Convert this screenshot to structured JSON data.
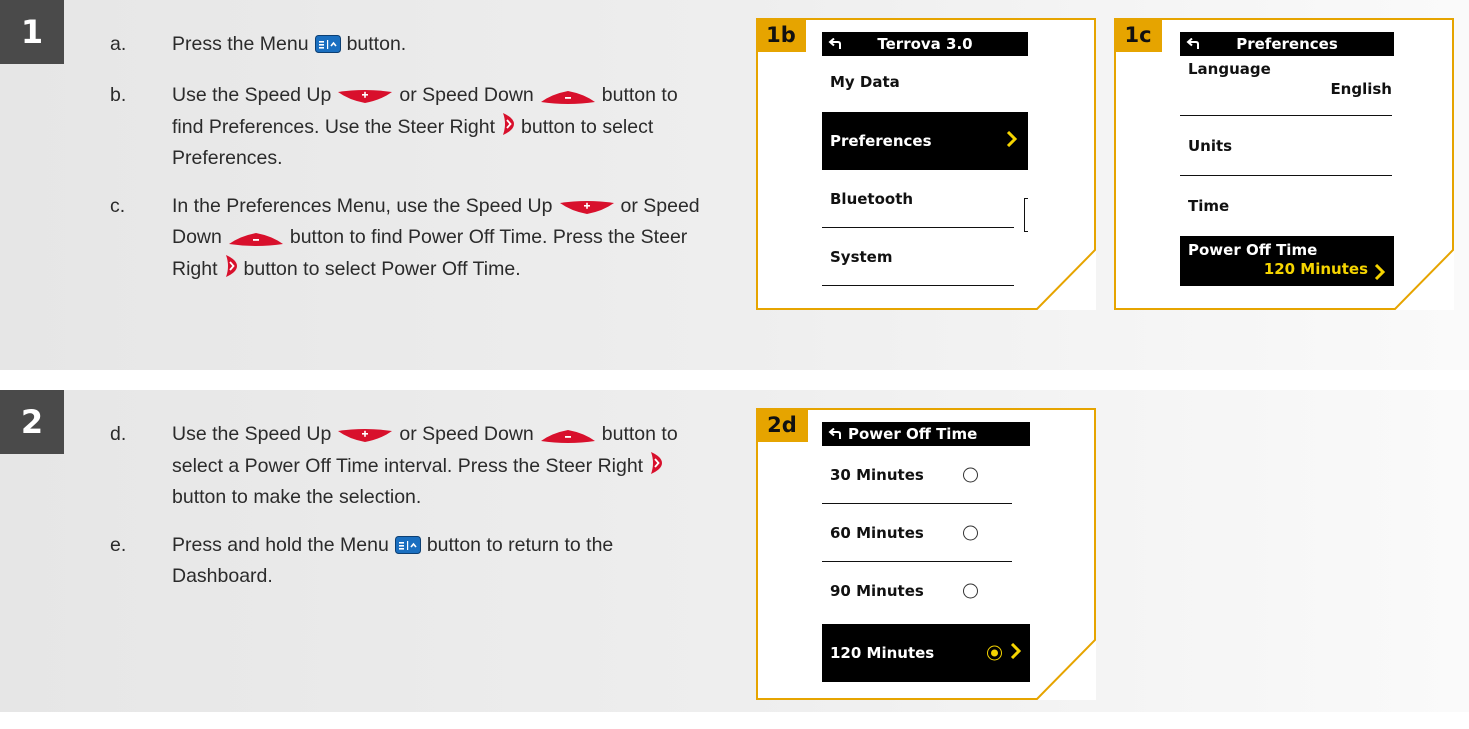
{
  "steps": [
    {
      "number": "1",
      "instructions": [
        {
          "letter": "a.",
          "parts": [
            "Press the Menu",
            "button."
          ]
        },
        {
          "letter": "b.",
          "parts": [
            "Use the Speed Up",
            "or Speed Down",
            "button to find Preferences. Use the Steer Right",
            "button to select Preferences."
          ]
        },
        {
          "letter": "c.",
          "parts": [
            "In the Preferences Menu, use the Speed Up",
            "or Speed Down",
            "button to find Power Off Time. Press the Steer Right",
            "button to select Power Off Time."
          ]
        }
      ]
    },
    {
      "number": "2",
      "instructions": [
        {
          "letter": "d.",
          "parts": [
            "Use the Speed Up",
            "or Speed Down",
            "button to select a Power Off Time interval. Press the Steer Right",
            "button to make the selection."
          ]
        },
        {
          "letter": "e.",
          "parts": [
            "Press and hold the Menu",
            "button to return to the Dashboard."
          ]
        }
      ]
    }
  ],
  "panels": {
    "p1b": {
      "label": "1b",
      "title": "Terrova 3.0",
      "items": [
        {
          "label": "My Data",
          "selected": false
        },
        {
          "label": "Preferences",
          "selected": true
        },
        {
          "label": "Bluetooth",
          "selected": false
        },
        {
          "label": "System",
          "selected": false
        }
      ]
    },
    "p1c": {
      "label": "1c",
      "title": "Preferences",
      "items": [
        {
          "label": "Language",
          "value": "English",
          "selected": false
        },
        {
          "label": "Units",
          "value": "",
          "selected": false
        },
        {
          "label": "Time",
          "value": "",
          "selected": false
        },
        {
          "label": "Power Off Time",
          "value": "120 Minutes",
          "selected": true
        }
      ]
    },
    "p2d": {
      "label": "2d",
      "title": "Power Off Time",
      "items": [
        {
          "label": "30 Minutes",
          "selected": false
        },
        {
          "label": "60 Minutes",
          "selected": false
        },
        {
          "label": "90 Minutes",
          "selected": false
        },
        {
          "label": "120 Minutes",
          "selected": true
        }
      ]
    }
  },
  "colors": {
    "badge": "#4a4a4a",
    "panel_label": "#e6a400",
    "panel_frame": "#e6a400",
    "highlight_text": "#f5d400",
    "speed_button": "#d8102c",
    "menu_button": "#1a6fc0"
  }
}
